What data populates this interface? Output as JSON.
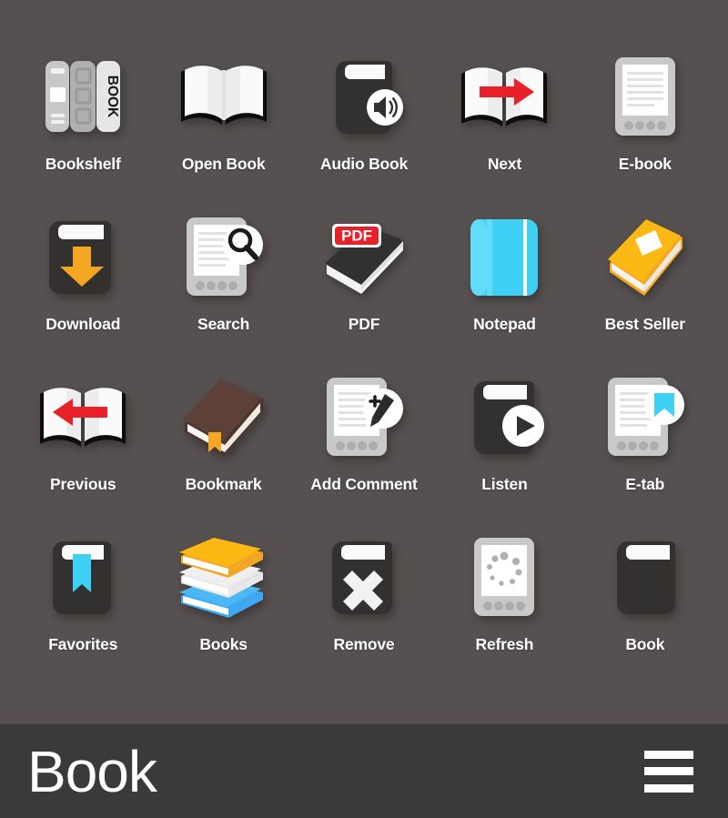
{
  "app": {
    "background_color": "#565150",
    "bar_color": "#3a3a3a",
    "accent_orange": "#F5A623",
    "accent_blue": "#3FD0F5",
    "accent_red": "#E8202A",
    "accent_brown": "#4E342E",
    "dark": "#333130",
    "light": "#C9C9C9"
  },
  "bottom_bar": {
    "title": "Book",
    "menu_icon": "hamburger-menu-icon"
  },
  "grid": {
    "columns": 5,
    "rows": 4,
    "items": [
      {
        "label": "Bookshelf",
        "icon": "bookshelf-icon",
        "spine_text": "BOOK"
      },
      {
        "label": "Open Book",
        "icon": "open-book-icon"
      },
      {
        "label": "Audio Book",
        "icon": "audio-book-icon"
      },
      {
        "label": "Next",
        "icon": "next-book-icon"
      },
      {
        "label": "E-book",
        "icon": "e-book-reader-icon"
      },
      {
        "label": "Download",
        "icon": "download-book-icon"
      },
      {
        "label": "Search",
        "icon": "search-book-icon"
      },
      {
        "label": "PDF",
        "icon": "pdf-book-icon",
        "badge_text": "PDF"
      },
      {
        "label": "Notepad",
        "icon": "notepad-icon"
      },
      {
        "label": "Best Seller",
        "icon": "best-seller-book-icon"
      },
      {
        "label": "Previous",
        "icon": "previous-book-icon"
      },
      {
        "label": "Bookmark",
        "icon": "bookmark-book-icon"
      },
      {
        "label": "Add Comment",
        "icon": "add-comment-icon"
      },
      {
        "label": "Listen",
        "icon": "listen-book-icon"
      },
      {
        "label": "E-tab",
        "icon": "e-tab-icon"
      },
      {
        "label": "Favorites",
        "icon": "favorites-book-icon"
      },
      {
        "label": "Books",
        "icon": "books-stack-icon"
      },
      {
        "label": "Remove",
        "icon": "remove-book-icon"
      },
      {
        "label": "Refresh",
        "icon": "refresh-reader-icon"
      },
      {
        "label": "Book",
        "icon": "book-icon"
      }
    ]
  }
}
